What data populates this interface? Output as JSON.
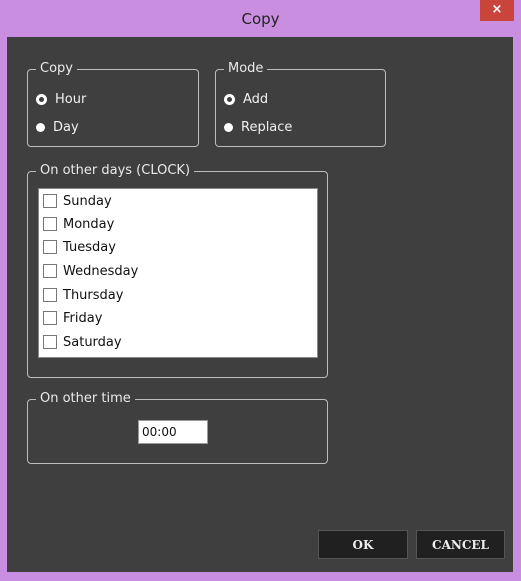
{
  "window": {
    "title": "Copy",
    "close_glyph": "×"
  },
  "copy_group": {
    "legend": "Copy",
    "options": [
      {
        "label": "Hour",
        "checked": true
      },
      {
        "label": "Day",
        "checked": false
      }
    ]
  },
  "mode_group": {
    "legend": "Mode",
    "options": [
      {
        "label": "Add",
        "checked": true
      },
      {
        "label": "Replace",
        "checked": false
      }
    ]
  },
  "days_group": {
    "legend": "On other days (CLOCK)",
    "days": [
      {
        "label": "Sunday",
        "checked": false
      },
      {
        "label": "Monday",
        "checked": false
      },
      {
        "label": "Tuesday",
        "checked": false
      },
      {
        "label": "Wednesday",
        "checked": false
      },
      {
        "label": "Thursday",
        "checked": false
      },
      {
        "label": "Friday",
        "checked": false
      },
      {
        "label": "Saturday",
        "checked": false
      }
    ]
  },
  "time_group": {
    "legend": "On other time",
    "value": "00:00"
  },
  "buttons": {
    "ok": "OK",
    "cancel": "CANCEL"
  },
  "colors": {
    "frame": "#c98ee0",
    "client": "#3f3f3f",
    "close": "#c9443a",
    "button": "#202020"
  }
}
